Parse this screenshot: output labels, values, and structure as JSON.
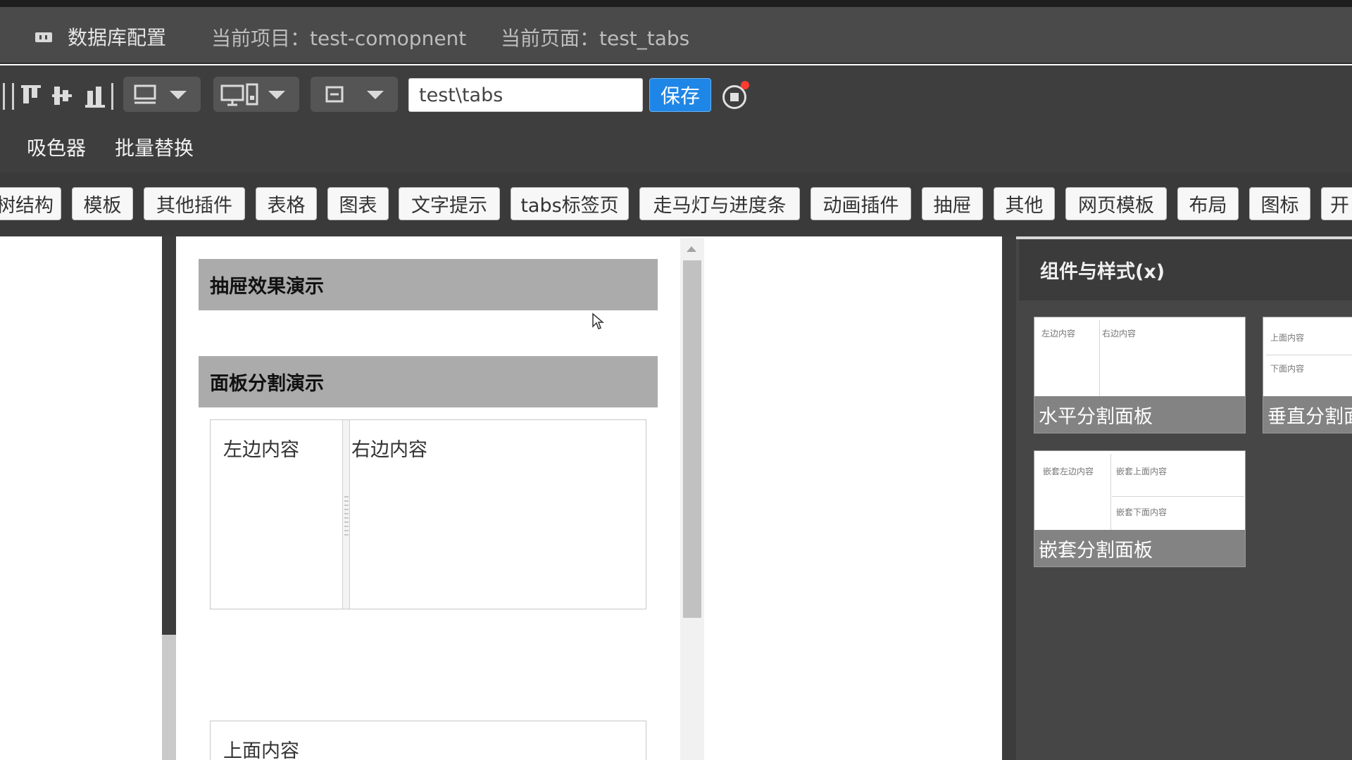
{
  "header": {
    "db_config": "数据库配置",
    "current_project": "当前项目：test-comopnent",
    "current_page": "当前页面：test_tabs"
  },
  "toolbar": {
    "path_value": "test\\tabs",
    "save_label": "保存",
    "color_picker": "吸色器",
    "batch_replace": "批量替换"
  },
  "categories": [
    "树结构",
    "模板",
    "其他插件",
    "表格",
    "图表",
    "文字提示",
    "tabs标签页",
    "走马灯与进度条",
    "动画插件",
    "抽屉",
    "其他",
    "网页模板",
    "布局",
    "图标",
    "开"
  ],
  "canvas": {
    "drawer_demo_title": "抽屉效果演示",
    "panel_split_title": "面板分割演示",
    "left_content": "左边内容",
    "right_content": "右边内容",
    "top_content": "上面内容"
  },
  "panel": {
    "title": "组件与样式(x)",
    "components": [
      {
        "caption": "水平分割面板",
        "thumb_texts": [
          "左边内容",
          "右边内容"
        ]
      },
      {
        "caption": "垂直分割面板",
        "thumb_texts": [
          "上面内容",
          "下面内容"
        ]
      },
      {
        "caption": "嵌套分割面板",
        "thumb_texts": [
          "嵌套左边内容",
          "嵌套上面内容",
          "嵌套下面内容"
        ]
      }
    ]
  },
  "colors": {
    "header_bg": "#4a4a4a",
    "toolbar_bg": "#3e3e3e",
    "save_button": "#1e86e6",
    "drawer_header": "#ababab",
    "record_dot": "#ff3b30"
  },
  "icons": [
    "database-icon",
    "align-top-icon",
    "align-center-icon",
    "align-bottom-icon",
    "layout-icon",
    "device-icon",
    "fit-icon",
    "record-icon",
    "mouse-cursor-icon"
  ]
}
